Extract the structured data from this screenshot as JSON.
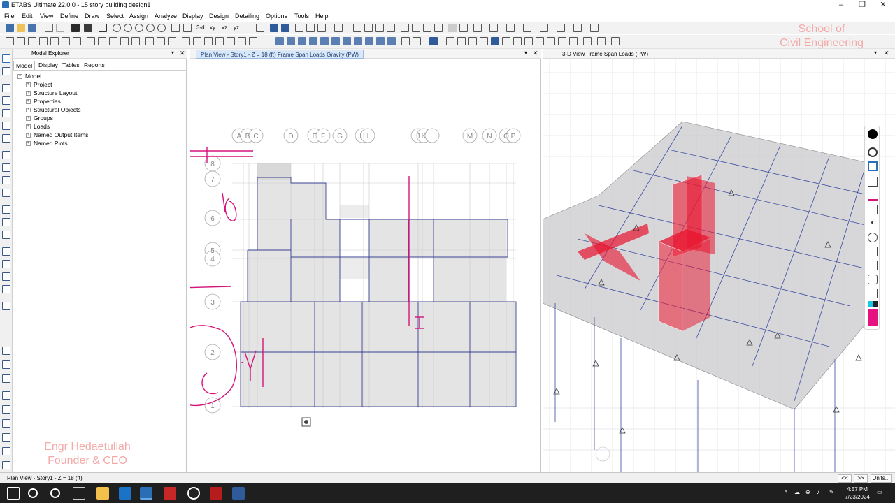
{
  "app": {
    "title": "ETABS Ultimate 22.0.0 - 15 story building design1",
    "menus": [
      "File",
      "Edit",
      "View",
      "Define",
      "Draw",
      "Select",
      "Assign",
      "Analyze",
      "Display",
      "Design",
      "Detailing",
      "Options",
      "Tools",
      "Help"
    ]
  },
  "toolbar": {
    "view_3d_label": "3-d",
    "view_xy_label": "xy",
    "view_xz_label": "xz",
    "view_yz_label": "yz"
  },
  "explorer": {
    "title": "Model Explorer",
    "tabs": [
      "Model",
      "Display",
      "Tables",
      "Reports"
    ],
    "root": "Model",
    "items": [
      "Project",
      "Structure Layout",
      "Properties",
      "Structural Objects",
      "Groups",
      "Loads",
      "Named Output Items",
      "Named Plots"
    ]
  },
  "plan_view": {
    "tab_title": "Plan View - Story1 - Z = 18 (ft)  Frame Span Loads Gravity (PW)",
    "grid_x": [
      "A",
      "B",
      "C",
      "D",
      "E",
      "F",
      "G",
      "H",
      "I",
      "J",
      "K",
      "L",
      "M",
      "N",
      "O",
      "P"
    ],
    "grid_y": [
      "8",
      "7",
      "6",
      "5",
      "4",
      "3",
      "2",
      "1"
    ]
  },
  "view_3d": {
    "tab_title": "3-D View  Frame Span Loads (PW)"
  },
  "watermark": {
    "top_line1": "School of",
    "top_line2": "Civil Engineering",
    "bottom_line1": "Engr Hedaetullah",
    "bottom_line2": "Founder & CEO"
  },
  "status": {
    "text": "Plan View - Story1 - Z = 18 (ft)",
    "nav_prev": "<<",
    "nav_next": ">>",
    "units_button": "Units..."
  },
  "taskbar": {
    "time": "4:57 PM",
    "date": "7/23/2024"
  },
  "colors": {
    "accent_blue": "#2a6fb5",
    "annotation_pink": "#d6157a",
    "load_red": "#e8132e",
    "grid_blue": "#3a3f8f"
  }
}
